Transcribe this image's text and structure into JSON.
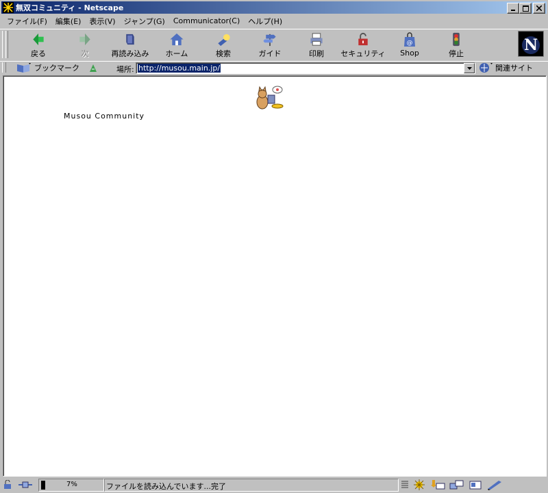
{
  "window": {
    "title": "無双コミュニティ - Netscape"
  },
  "menu": [
    "ファイル(F)",
    "編集(E)",
    "表示(V)",
    "ジャンプ(G)",
    "Communicator(C)",
    "ヘルプ(H)"
  ],
  "toolbar": {
    "back": "戻る",
    "forward": "次",
    "reload": "再読み込み",
    "home": "ホーム",
    "search": "検索",
    "guide": "ガイド",
    "print": "印刷",
    "security": "セキュリティ",
    "shop": "Shop",
    "stop": "停止"
  },
  "location": {
    "bookmarks": "ブックマーク",
    "label": "場所:",
    "url": "http://musou.main.jp/",
    "related": "関連サイト"
  },
  "content": {
    "site_name": "Musou Community"
  },
  "status": {
    "progress": "7%",
    "progress_value": 0.07,
    "message": "ファイルを読み込んでいます...完了"
  },
  "colors": {
    "titlebar_start": "#0a246a",
    "titlebar_end": "#a6caf0",
    "chrome": "#c0c0c0",
    "selection": "#0a246a"
  }
}
